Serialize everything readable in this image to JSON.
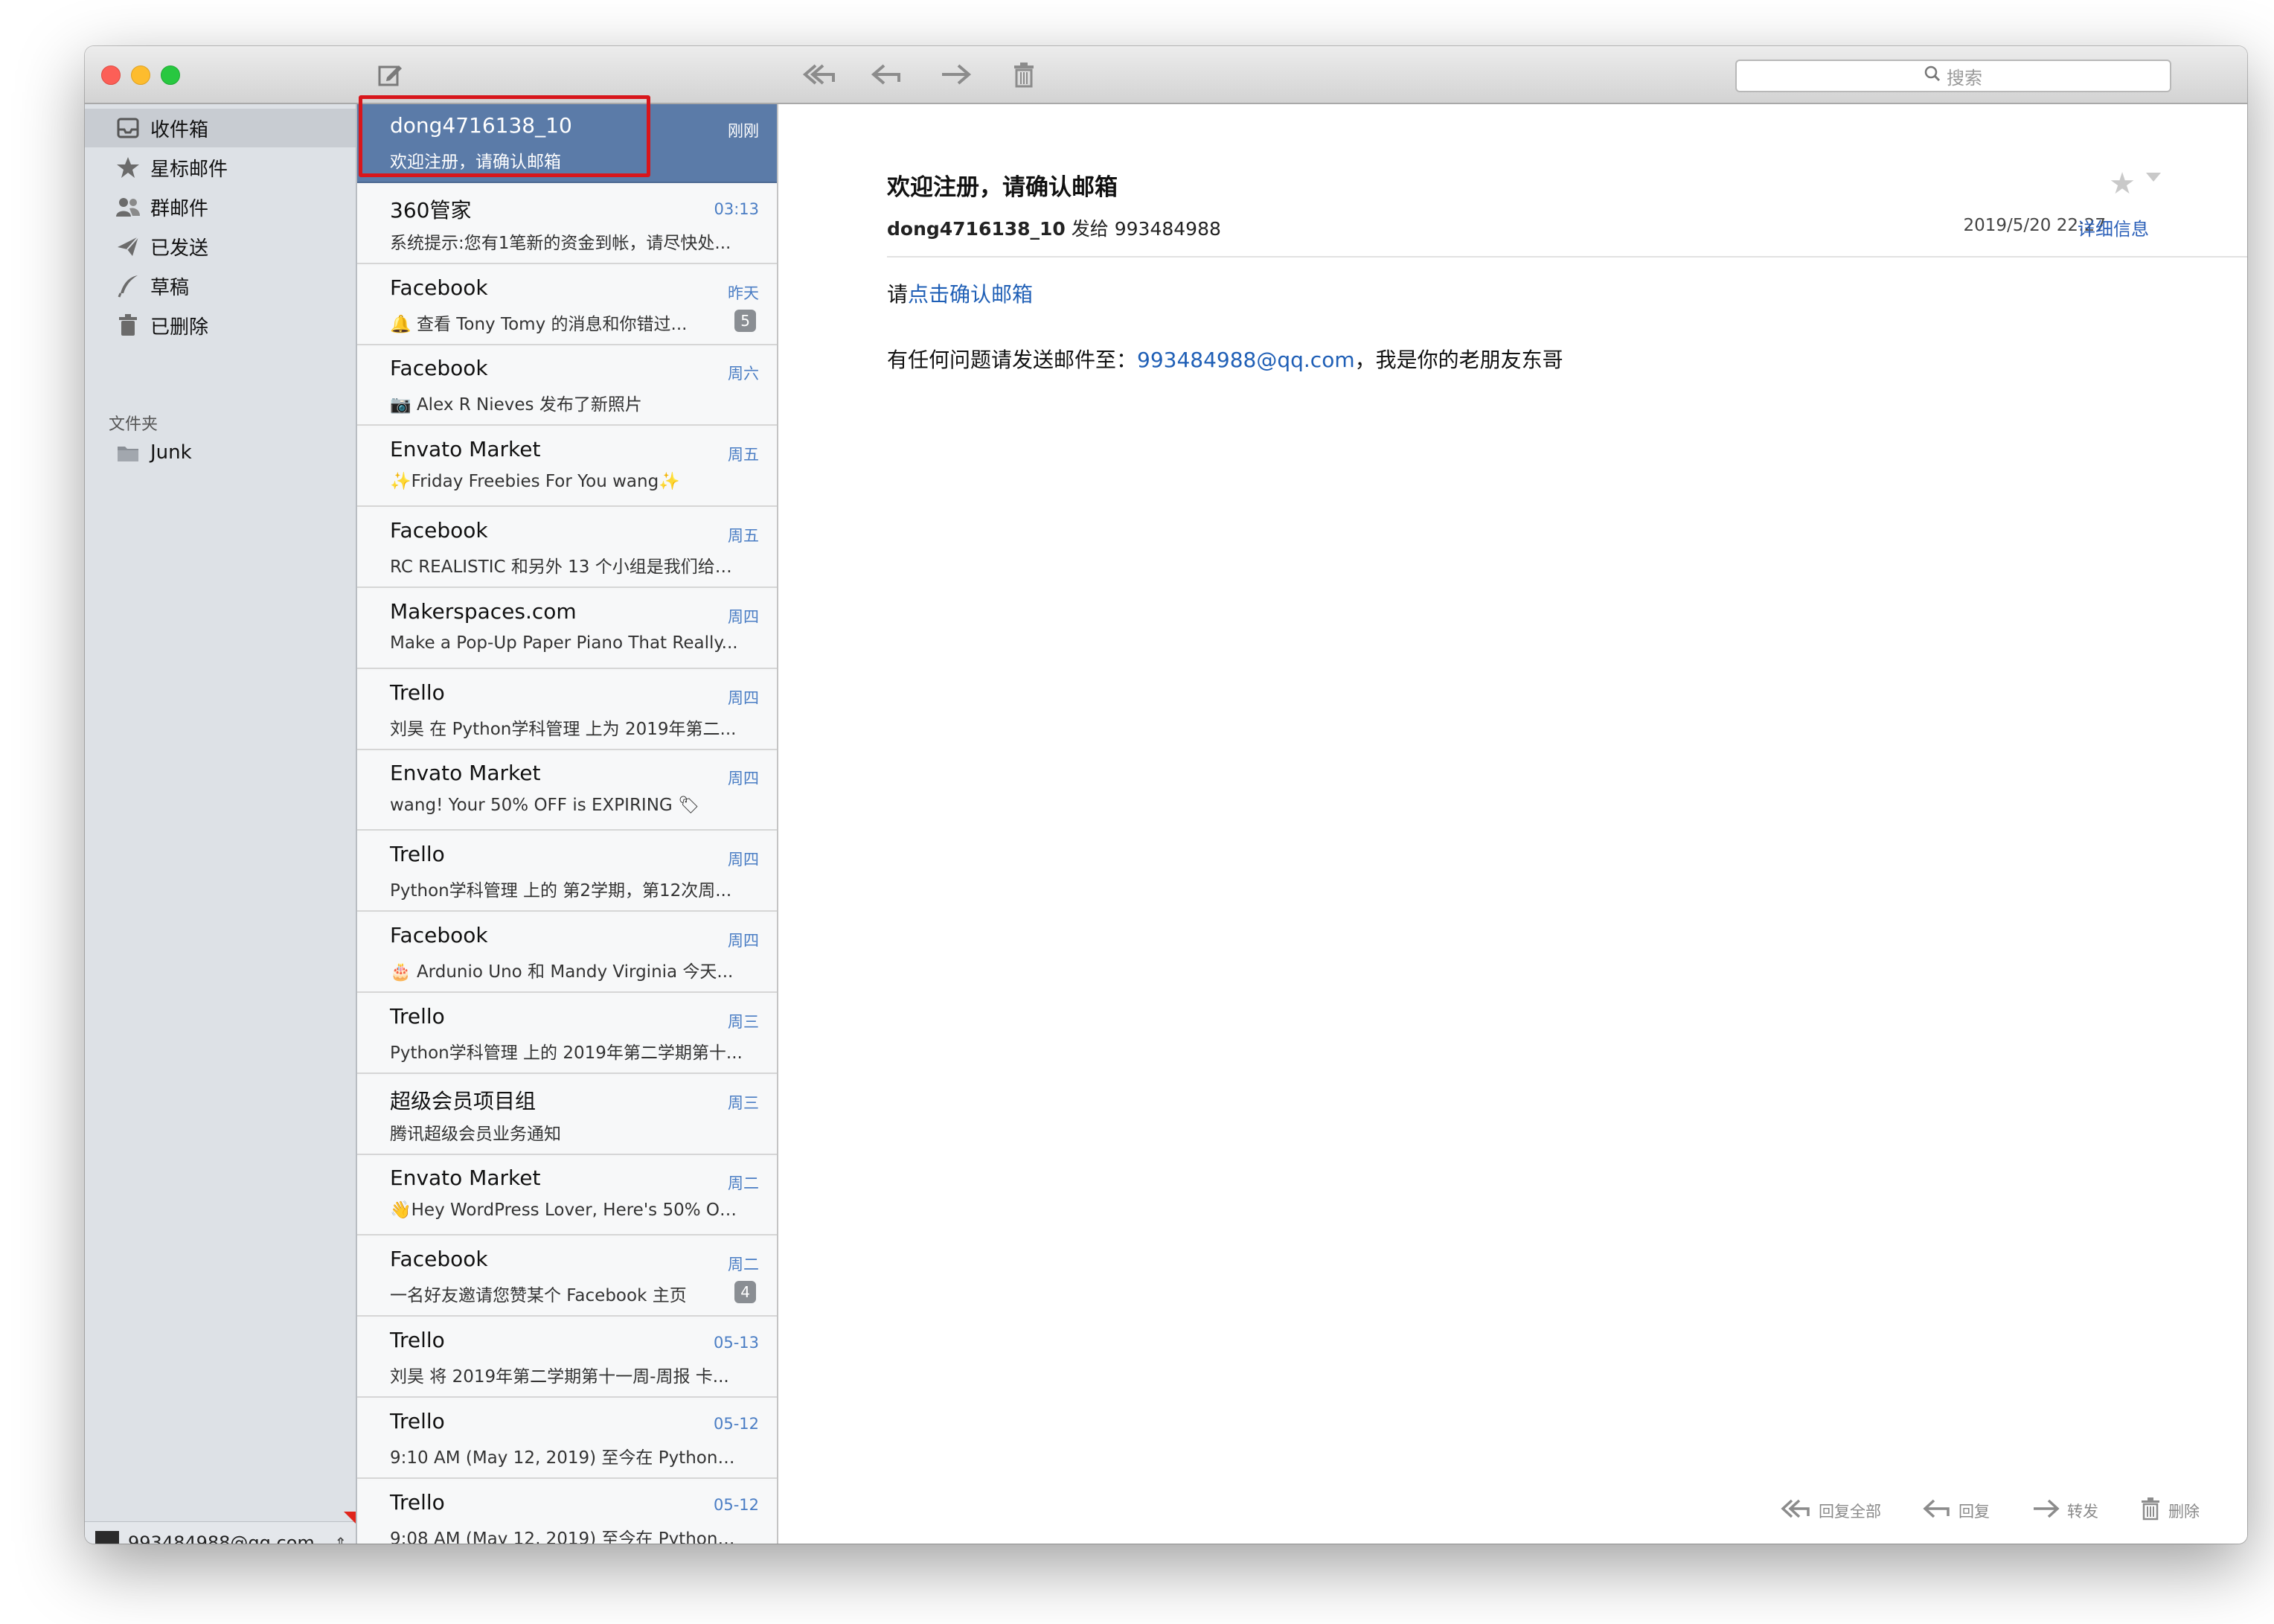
{
  "toolbar": {
    "search_placeholder": "搜索",
    "icons": [
      "compose-icon",
      "reply-all-icon",
      "reply-icon",
      "forward-icon",
      "trash-icon"
    ]
  },
  "sidebar": {
    "items": [
      {
        "label": "收件箱",
        "icon": "inbox-icon"
      },
      {
        "label": "星标邮件",
        "icon": "star-icon"
      },
      {
        "label": "群邮件",
        "icon": "group-icon"
      },
      {
        "label": "已发送",
        "icon": "sent-icon"
      },
      {
        "label": "草稿",
        "icon": "draft-icon"
      },
      {
        "label": "已删除",
        "icon": "trash-icon"
      }
    ],
    "folders_heading": "文件夹",
    "folders": [
      {
        "label": "Junk",
        "icon": "folder-icon"
      }
    ],
    "account": "993484988@qq.com"
  },
  "messages": [
    {
      "sender": "dong4716138_10",
      "date": "刚刚",
      "preview": "欢迎注册，请确认邮箱",
      "selected": true
    },
    {
      "sender": "360管家",
      "date": "03:13",
      "preview": "系统提示:您有1笔新的资金到帐，请尽快处..."
    },
    {
      "sender": "Facebook",
      "date": "昨天",
      "preview": "🔔 查看 Tony Tomy 的消息和你错过...",
      "badge": "5"
    },
    {
      "sender": "Facebook",
      "date": "周六",
      "preview": "📷 Alex R Nieves 发布了新照片"
    },
    {
      "sender": "Envato Market",
      "date": "周五",
      "preview": "✨Friday Freebies For You wang✨"
    },
    {
      "sender": "Facebook",
      "date": "周五",
      "preview": "RC REALISTIC 和另外 13 个小组是我们给你..."
    },
    {
      "sender": "Makerspaces.com",
      "date": "周四",
      "preview": "Make a Pop-Up Paper Piano That Really..."
    },
    {
      "sender": "Trello",
      "date": "周四",
      "preview": "刘昊 在 Python学科管理 上为 2019年第二..."
    },
    {
      "sender": "Envato Market",
      "date": "周四",
      "preview": "wang! Your 50% OFF is EXPIRING 🏷"
    },
    {
      "sender": "Trello",
      "date": "周四",
      "preview": "Python学科管理 上的 第2学期，第12次周..."
    },
    {
      "sender": "Facebook",
      "date": "周四",
      "preview": "🎂 Ardunio Uno 和 Mandy Virginia 今天..."
    },
    {
      "sender": "Trello",
      "date": "周三",
      "preview": "Python学科管理 上的 2019年第二学期第十..."
    },
    {
      "sender": "超级会员项目组",
      "date": "周三",
      "preview": "腾讯超级会员业务通知"
    },
    {
      "sender": "Envato Market",
      "date": "周二",
      "preview": "👋Hey WordPress Lover, Here's 50% OFF..."
    },
    {
      "sender": "Facebook",
      "date": "周二",
      "preview": "一名好友邀请您赞某个 Facebook 主页",
      "badge": "4"
    },
    {
      "sender": "Trello",
      "date": "05-13",
      "preview": "刘昊 将 2019年第二学期第十一周-周报 卡..."
    },
    {
      "sender": "Trello",
      "date": "05-12",
      "preview": "9:10 AM (May 12, 2019) 至今在 Python学..."
    },
    {
      "sender": "Trello",
      "date": "05-12",
      "preview": "9:08 AM (May 12, 2019) 至今在 Python学..."
    }
  ],
  "reader": {
    "subject": "欢迎注册，请确认邮箱",
    "from": "dong4716138_10",
    "sent_to_label": "发给",
    "to": "993484988",
    "datetime": "2019/5/20  22:27",
    "details_link": "详细信息",
    "body_prefix": "请",
    "body_link": "点击确认邮箱",
    "contact_prefix": "有任何问题请发送邮件至：",
    "contact_email": "993484988@qq.com",
    "contact_suffix": "，我是你的老朋友东哥",
    "actions": [
      {
        "label": "回复全部",
        "icon": "reply-all-icon"
      },
      {
        "label": "回复",
        "icon": "reply-icon"
      },
      {
        "label": "转发",
        "icon": "forward-icon"
      },
      {
        "label": "删除",
        "icon": "trash-icon"
      }
    ]
  }
}
